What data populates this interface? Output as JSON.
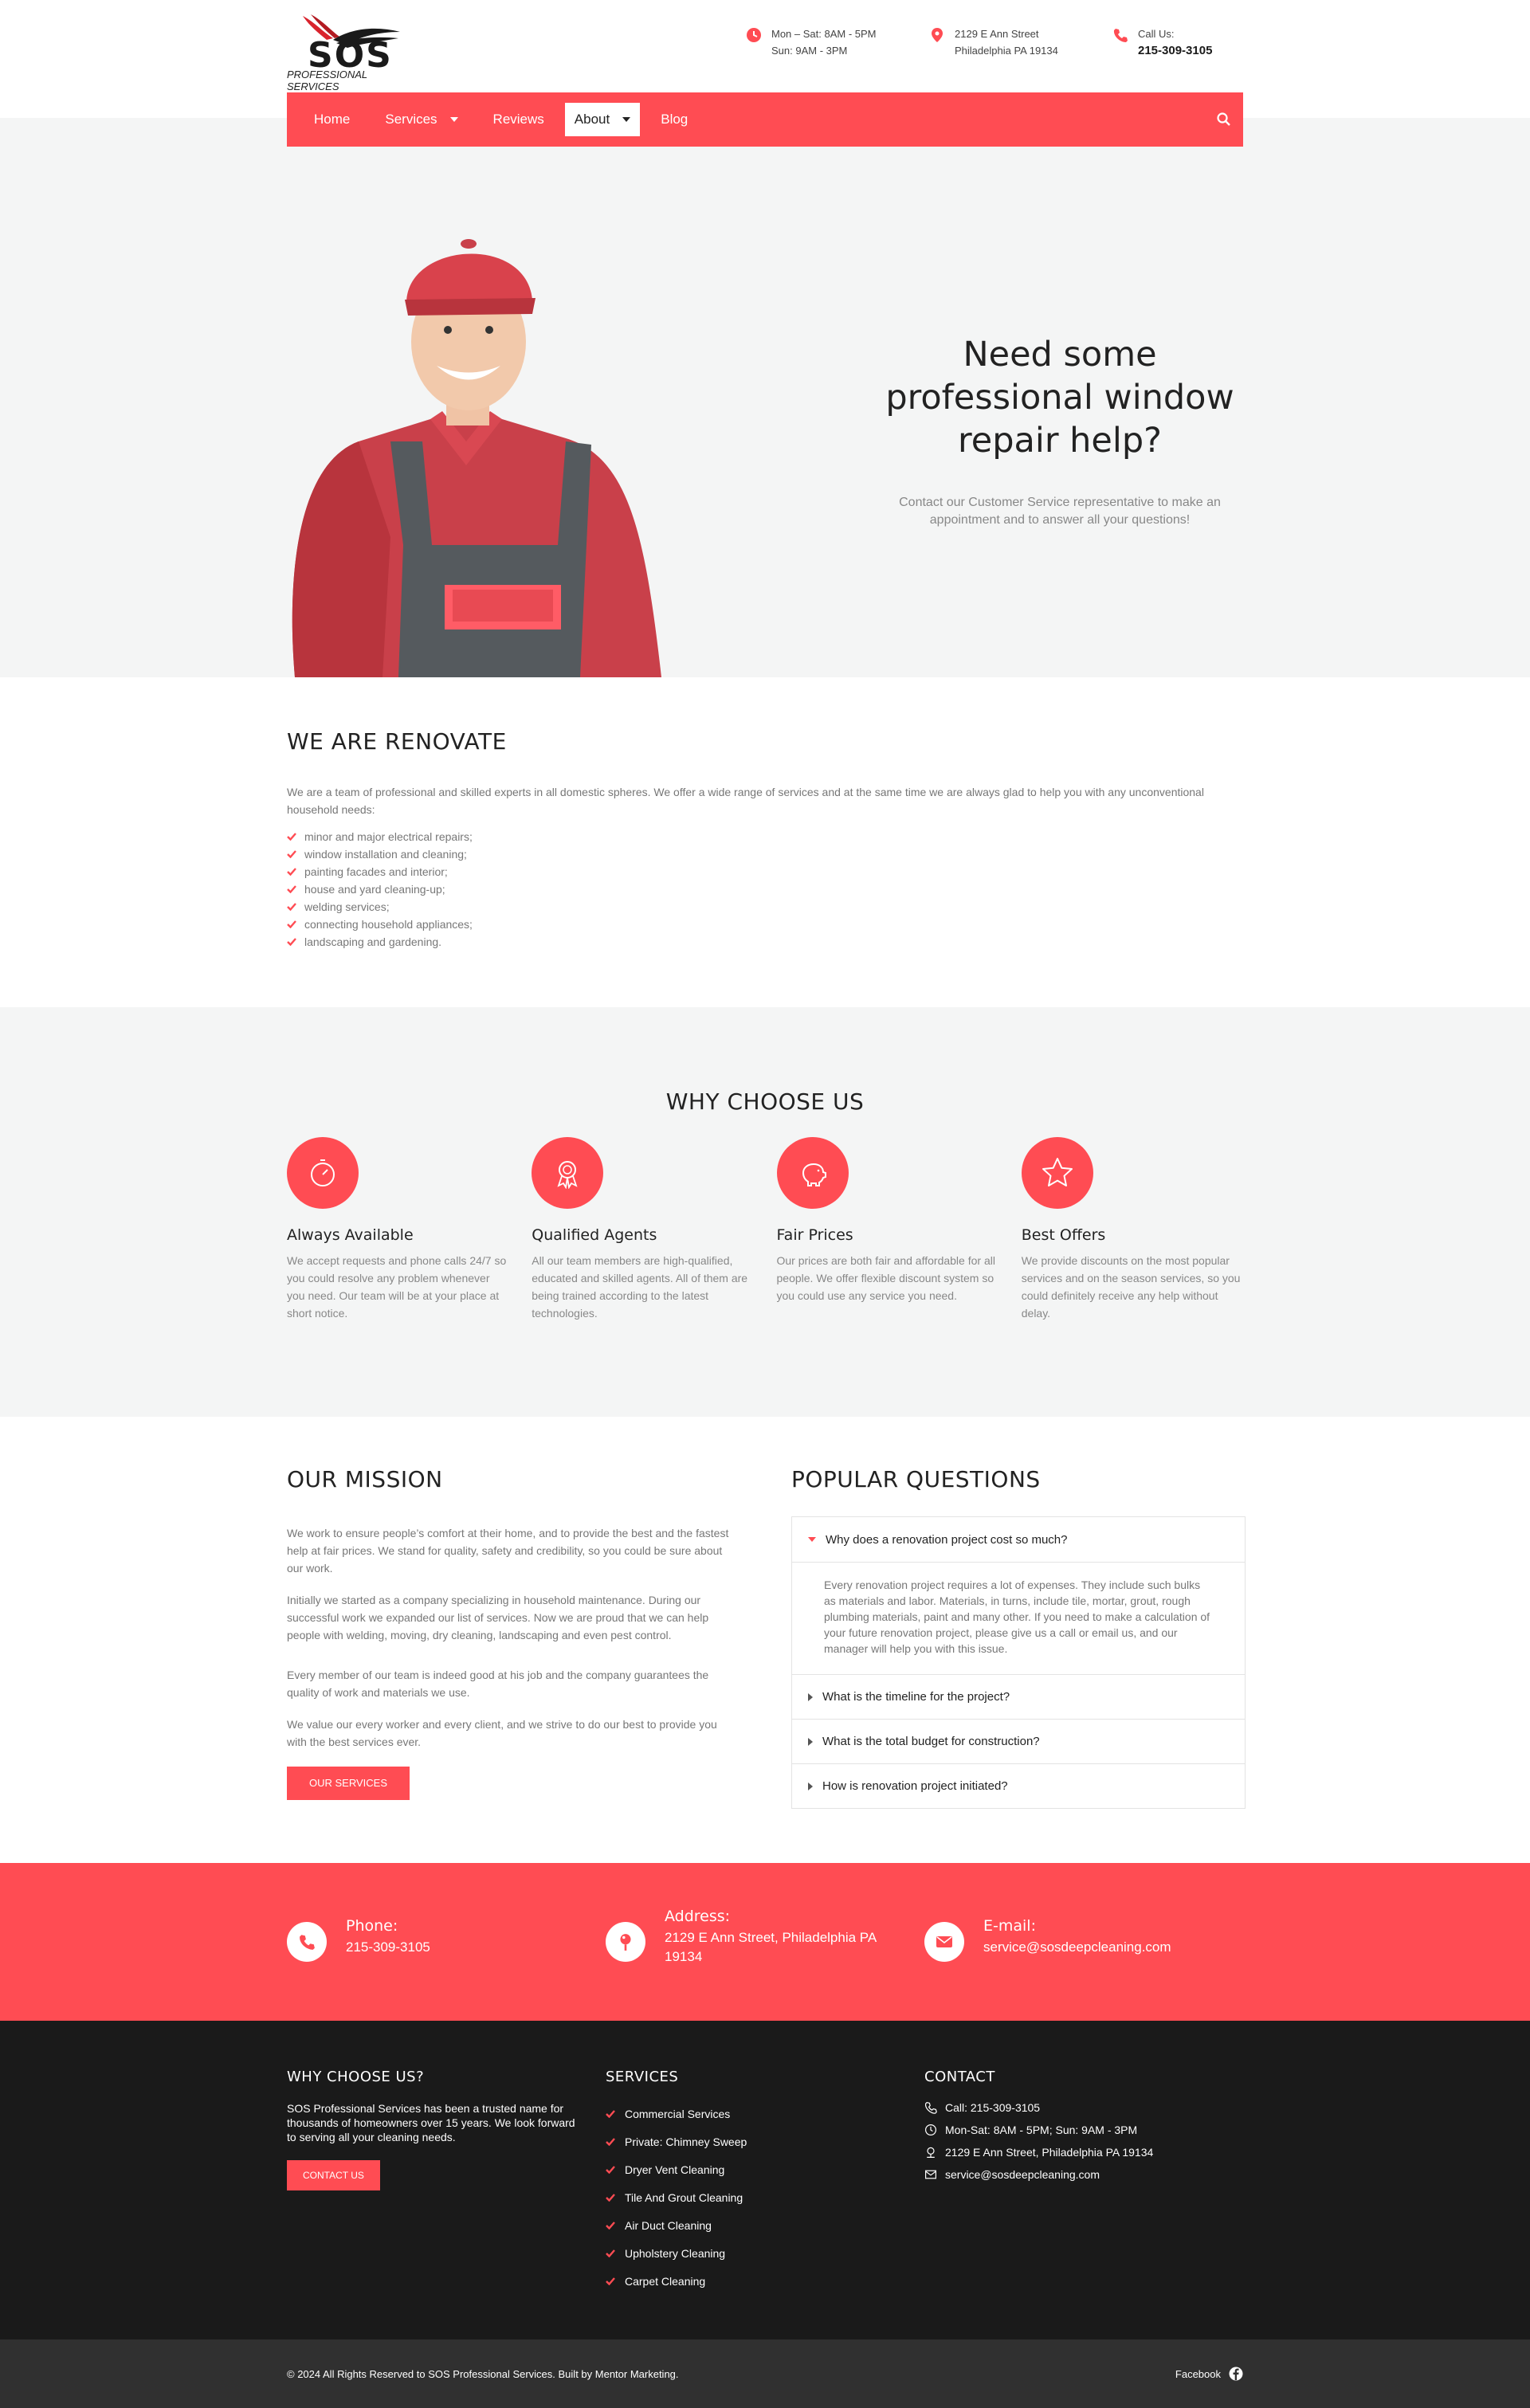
{
  "colors": {
    "accent": "#ff4c53",
    "dark": "#1a1a1a",
    "light_bg": "#f4f5f5"
  },
  "header": {
    "logo_text": "SOS",
    "logo_sub": "PROFESSIONAL SERVICES",
    "hours": {
      "line1": "Mon – Sat: 8AM - 5PM",
      "line2": "Sun: 9AM - 3PM",
      "icon": "clock-icon"
    },
    "address": {
      "line1": "2129 E Ann Street",
      "line2": "Philadelphia PA 19134",
      "icon": "map-pin-icon"
    },
    "call": {
      "label": "Call Us:",
      "number": "215-309-3105",
      "icon": "phone-icon"
    }
  },
  "nav": {
    "items": [
      {
        "label": "Home"
      },
      {
        "label": "Services"
      },
      {
        "label": "Reviews"
      },
      {
        "label": "About"
      },
      {
        "label": "Blog"
      }
    ],
    "active": "About"
  },
  "hero": {
    "title": "Need some professional window repair help?",
    "text": "Contact our Customer Service representative to make an appointment and to answer all your questions!"
  },
  "renovate": {
    "title": "WE ARE RENOVATE",
    "lead": "We are a team of professional and skilled experts in all domestic spheres. We offer a wide range of services and at the same time we are always glad to help you with any unconventional household needs:",
    "items": [
      "minor and major electrical repairs;",
      "window installation and cleaning;",
      "painting facades and interior;",
      "house and yard cleaning-up;",
      "welding services;",
      "connecting household appliances;",
      "landscaping and gardening."
    ]
  },
  "why": {
    "title": "WHY CHOOSE US",
    "features": [
      {
        "title": "Always Available",
        "text": "We accept requests and phone calls 24/7 so you could resolve any problem whenever you need. Our team will be at your place at short notice.",
        "icon": "stopwatch-icon"
      },
      {
        "title": "Qualified Agents",
        "text": "All our team members are high-qualified, educated and skilled agents. All of them are being trained according to the latest technologies.",
        "icon": "award-icon"
      },
      {
        "title": "Fair Prices",
        "text": "Our prices are both fair and affordable for all people. We offer flexible discount system so you could use any service you need.",
        "icon": "piggy-bank-icon"
      },
      {
        "title": "Best Offers",
        "text": "We provide discounts on the most popular services and on the season services, so you could definitely receive any help without delay.",
        "icon": "star-icon"
      }
    ]
  },
  "mission": {
    "title": "OUR MISSION",
    "paragraphs": [
      "We work to ensure people’s comfort at their home, and to provide the best and the fastest help at fair prices. We stand for quality, safety and credibility, so you could be sure about our work.",
      "Initially we started as a company specializing in household maintenance. During our successful work we expanded our list of services. Now we are proud that we can help people with welding, moving, dry cleaning, landscaping and even pest control.",
      "Every member of our team is indeed good at his job and the company guarantees the quality of work and materials we use.",
      "We value our every worker and every client, and we strive to do our best to provide you with the best services ever."
    ],
    "button": "OUR SERVICES"
  },
  "faq": {
    "title": "POPULAR QUESTIONS",
    "items": [
      {
        "q": "Why does a renovation project cost so much?",
        "a": "Every renovation project requires a lot of expenses. They include such bulks as materials and labor. Materials, in turns, include tile, mortar, grout, rough plumbing materials, paint and many other. If you need to  make a calculation of your future renovation project, please give us a call or email us, and our manager will help you with this issue."
      },
      {
        "q": "What is the timeline for the project?"
      },
      {
        "q": "What is the total budget for construction?"
      },
      {
        "q": "How is renovation project initiated?"
      }
    ]
  },
  "contact_band": {
    "phone": {
      "label": "Phone:",
      "value": "215-309-3105"
    },
    "address": {
      "label": "Address:",
      "value": "2129 E Ann Street, Philadelphia PA 19134"
    },
    "email": {
      "label": "E-mail:",
      "value": "service@sosdeepcleaning.com"
    }
  },
  "footer": {
    "why": {
      "title": "WHY CHOOSE US?",
      "text": "SOS Professional Services has been a trusted name for thousands of homeowners over 15 years. We look forward to serving all your cleaning needs.",
      "button": "CONTACT US"
    },
    "services": {
      "title": "SERVICES",
      "items": [
        "Commercial Services",
        "Private: Chimney Sweep",
        "Dryer Vent Cleaning",
        "Tile And Grout Cleaning",
        "Air Duct Cleaning",
        "Upholstery Cleaning",
        "Carpet Cleaning"
      ]
    },
    "contact": {
      "title": "CONTACT",
      "items": [
        "Call: 215-309-3105",
        "Mon-Sat: 8AM - 5PM; Sun: 9AM - 3PM",
        "2129 E Ann Street, Philadelphia PA 19134",
        "service@sosdeepcleaning.com"
      ]
    }
  },
  "copyright": {
    "text": "© 2024 All Rights Reserved to SOS Professional Services. Built by Mentor Marketing.",
    "social": "Facebook"
  }
}
